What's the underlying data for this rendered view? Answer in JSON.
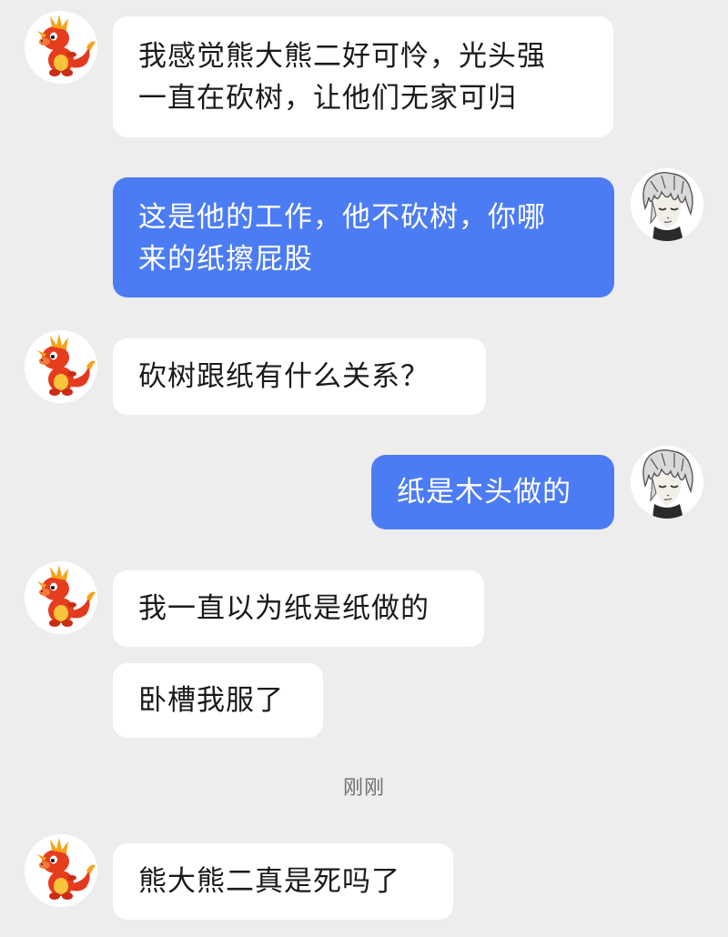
{
  "colors": {
    "background": "#ededed",
    "incoming_bubble": "#ffffff",
    "outgoing_bubble": "#4c7cf3",
    "timestamp_text": "#6f6f6f"
  },
  "contact_avatar": "dragon-mascot-avatar",
  "user_avatar": "anime-silver-hair-avatar",
  "messages": [
    {
      "sender": "contact",
      "lines": [
        "我感觉熊大熊二好可怜，光头强",
        "一直在砍树，让他们无家可归"
      ]
    },
    {
      "sender": "user",
      "lines": [
        "这是他的工作，他不砍树，你哪",
        "来的纸擦屁股"
      ]
    },
    {
      "sender": "contact",
      "lines": [
        "砍树跟纸有什么关系？"
      ]
    },
    {
      "sender": "user",
      "lines": [
        "纸是木头做的"
      ]
    },
    {
      "sender": "contact",
      "lines": [
        "我一直以为纸是纸做的"
      ]
    },
    {
      "sender": "contact",
      "lines": [
        "卧槽我服了"
      ]
    },
    {
      "sender": "contact",
      "lines": [
        "熊大熊二真是死吗了"
      ]
    }
  ],
  "timestamp": "刚刚"
}
